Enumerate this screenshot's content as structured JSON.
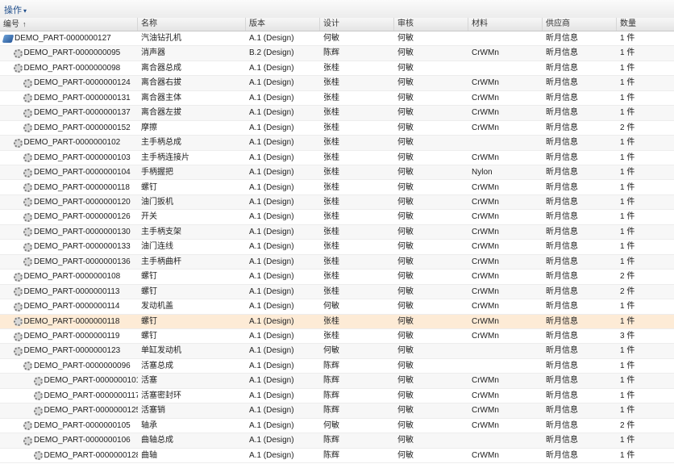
{
  "toolbar": {
    "action_label": "操作"
  },
  "columns": {
    "number": "编号",
    "name": "名称",
    "version": "版本",
    "design": "设计",
    "review": "审核",
    "material": "材料",
    "supplier": "供应商",
    "quantity": "数量"
  },
  "rows": [
    {
      "level": 0,
      "icon": "assembly-icon",
      "number": "DEMO_PART-0000000127",
      "name": "汽油钻孔机",
      "version": "A.1 (Design)",
      "design": "何敏",
      "review": "何敏",
      "material": "",
      "supplier": "昕月信息",
      "quantity": "1 件"
    },
    {
      "level": 1,
      "icon": "gear-icon",
      "number": "DEMO_PART-0000000095",
      "name": "消声器",
      "version": "B.2 (Design)",
      "design": "陈辉",
      "review": "何敏",
      "material": "CrWMn",
      "supplier": "昕月信息",
      "quantity": "1 件"
    },
    {
      "level": 1,
      "icon": "gear-icon",
      "number": "DEMO_PART-0000000098",
      "name": "离合器总成",
      "version": "A.1 (Design)",
      "design": "张桂",
      "review": "何敏",
      "material": "",
      "supplier": "昕月信息",
      "quantity": "1 件"
    },
    {
      "level": 2,
      "icon": "gear-icon",
      "number": "DEMO_PART-0000000124",
      "name": "离合器右拔",
      "version": "A.1 (Design)",
      "design": "张桂",
      "review": "何敏",
      "material": "CrWMn",
      "supplier": "昕月信息",
      "quantity": "1 件"
    },
    {
      "level": 2,
      "icon": "gear-icon",
      "number": "DEMO_PART-0000000131",
      "name": "离合器主体",
      "version": "A.1 (Design)",
      "design": "张桂",
      "review": "何敏",
      "material": "CrWMn",
      "supplier": "昕月信息",
      "quantity": "1 件"
    },
    {
      "level": 2,
      "icon": "gear-icon",
      "number": "DEMO_PART-0000000137",
      "name": "离合器左拔",
      "version": "A.1 (Design)",
      "design": "张桂",
      "review": "何敏",
      "material": "CrWMn",
      "supplier": "昕月信息",
      "quantity": "1 件"
    },
    {
      "level": 2,
      "icon": "gear-icon",
      "number": "DEMO_PART-0000000152",
      "name": "摩擦",
      "version": "A.1 (Design)",
      "design": "张桂",
      "review": "何敏",
      "material": "CrWMn",
      "supplier": "昕月信息",
      "quantity": "2 件"
    },
    {
      "level": 1,
      "icon": "gear-icon",
      "number": "DEMO_PART-0000000102",
      "name": "主手柄总成",
      "version": "A.1 (Design)",
      "design": "张桂",
      "review": "何敏",
      "material": "",
      "supplier": "昕月信息",
      "quantity": "1 件"
    },
    {
      "level": 2,
      "icon": "gear-icon",
      "number": "DEMO_PART-0000000103",
      "name": "主手柄连接片",
      "version": "A.1 (Design)",
      "design": "张桂",
      "review": "何敏",
      "material": "CrWMn",
      "supplier": "昕月信息",
      "quantity": "1 件"
    },
    {
      "level": 2,
      "icon": "gear-icon",
      "number": "DEMO_PART-0000000104",
      "name": "手柄握把",
      "version": "A.1 (Design)",
      "design": "张桂",
      "review": "何敏",
      "material": "Nylon",
      "supplier": "昕月信息",
      "quantity": "1 件"
    },
    {
      "level": 2,
      "icon": "gear-icon",
      "number": "DEMO_PART-0000000118",
      "name": "螺钉",
      "version": "A.1 (Design)",
      "design": "张桂",
      "review": "何敏",
      "material": "CrWMn",
      "supplier": "昕月信息",
      "quantity": "1 件"
    },
    {
      "level": 2,
      "icon": "gear-icon",
      "number": "DEMO_PART-0000000120",
      "name": "油门扳机",
      "version": "A.1 (Design)",
      "design": "张桂",
      "review": "何敏",
      "material": "CrWMn",
      "supplier": "昕月信息",
      "quantity": "1 件"
    },
    {
      "level": 2,
      "icon": "gear-icon",
      "number": "DEMO_PART-0000000126",
      "name": "开关",
      "version": "A.1 (Design)",
      "design": "张桂",
      "review": "何敏",
      "material": "CrWMn",
      "supplier": "昕月信息",
      "quantity": "1 件"
    },
    {
      "level": 2,
      "icon": "gear-icon",
      "number": "DEMO_PART-0000000130",
      "name": "主手柄支架",
      "version": "A.1 (Design)",
      "design": "张桂",
      "review": "何敏",
      "material": "CrWMn",
      "supplier": "昕月信息",
      "quantity": "1 件"
    },
    {
      "level": 2,
      "icon": "gear-icon",
      "number": "DEMO_PART-0000000133",
      "name": "油门连线",
      "version": "A.1 (Design)",
      "design": "张桂",
      "review": "何敏",
      "material": "CrWMn",
      "supplier": "昕月信息",
      "quantity": "1 件"
    },
    {
      "level": 2,
      "icon": "gear-icon",
      "number": "DEMO_PART-0000000136",
      "name": "主手柄曲杆",
      "version": "A.1 (Design)",
      "design": "张桂",
      "review": "何敏",
      "material": "CrWMn",
      "supplier": "昕月信息",
      "quantity": "1 件"
    },
    {
      "level": 1,
      "icon": "gear-icon",
      "number": "DEMO_PART-0000000108",
      "name": "螺钉",
      "version": "A.1 (Design)",
      "design": "张桂",
      "review": "何敏",
      "material": "CrWMn",
      "supplier": "昕月信息",
      "quantity": "2 件"
    },
    {
      "level": 1,
      "icon": "gear-icon",
      "number": "DEMO_PART-0000000113",
      "name": "螺钉",
      "version": "A.1 (Design)",
      "design": "张桂",
      "review": "何敏",
      "material": "CrWMn",
      "supplier": "昕月信息",
      "quantity": "2 件"
    },
    {
      "level": 1,
      "icon": "gear-icon",
      "number": "DEMO_PART-0000000114",
      "name": "发动机盖",
      "version": "A.1 (Design)",
      "design": "何敏",
      "review": "何敏",
      "material": "CrWMn",
      "supplier": "昕月信息",
      "quantity": "1 件"
    },
    {
      "level": 1,
      "icon": "gear-icon",
      "number": "DEMO_PART-0000000118",
      "name": "螺钉",
      "version": "A.1 (Design)",
      "design": "张桂",
      "review": "何敏",
      "material": "CrWMn",
      "supplier": "昕月信息",
      "quantity": "1 件",
      "selected": true
    },
    {
      "level": 1,
      "icon": "gear-icon",
      "number": "DEMO_PART-0000000119",
      "name": "螺钉",
      "version": "A.1 (Design)",
      "design": "张桂",
      "review": "何敏",
      "material": "CrWMn",
      "supplier": "昕月信息",
      "quantity": "3 件"
    },
    {
      "level": 1,
      "icon": "gear-icon",
      "number": "DEMO_PART-0000000123",
      "name": "单缸发动机",
      "version": "A.1 (Design)",
      "design": "何敏",
      "review": "何敏",
      "material": "",
      "supplier": "昕月信息",
      "quantity": "1 件"
    },
    {
      "level": 2,
      "icon": "gear-icon",
      "number": "DEMO_PART-0000000096",
      "name": "活塞总成",
      "version": "A.1 (Design)",
      "design": "陈辉",
      "review": "何敏",
      "material": "",
      "supplier": "昕月信息",
      "quantity": "1 件"
    },
    {
      "level": 3,
      "icon": "gear-icon",
      "number": "DEMO_PART-0000000101",
      "name": "活塞",
      "version": "A.1 (Design)",
      "design": "陈辉",
      "review": "何敏",
      "material": "CrWMn",
      "supplier": "昕月信息",
      "quantity": "1 件"
    },
    {
      "level": 3,
      "icon": "gear-icon",
      "number": "DEMO_PART-0000000117",
      "name": "活塞密封环",
      "version": "A.1 (Design)",
      "design": "陈辉",
      "review": "何敏",
      "material": "CrWMn",
      "supplier": "昕月信息",
      "quantity": "1 件"
    },
    {
      "level": 3,
      "icon": "gear-icon",
      "number": "DEMO_PART-0000000125",
      "name": "活塞销",
      "version": "A.1 (Design)",
      "design": "陈辉",
      "review": "何敏",
      "material": "CrWMn",
      "supplier": "昕月信息",
      "quantity": "1 件"
    },
    {
      "level": 2,
      "icon": "gear-icon",
      "number": "DEMO_PART-0000000105",
      "name": "轴承",
      "version": "A.1 (Design)",
      "design": "何敏",
      "review": "何敏",
      "material": "CrWMn",
      "supplier": "昕月信息",
      "quantity": "2 件"
    },
    {
      "level": 2,
      "icon": "gear-icon",
      "number": "DEMO_PART-0000000106",
      "name": "曲轴总成",
      "version": "A.1 (Design)",
      "design": "陈辉",
      "review": "何敏",
      "material": "",
      "supplier": "昕月信息",
      "quantity": "1 件"
    },
    {
      "level": 3,
      "icon": "gear-icon",
      "number": "DEMO_PART-0000000128",
      "name": "曲轴",
      "version": "A.1 (Design)",
      "design": "陈辉",
      "review": "何敏",
      "material": "CrWMn",
      "supplier": "昕月信息",
      "quantity": "1 件"
    }
  ]
}
